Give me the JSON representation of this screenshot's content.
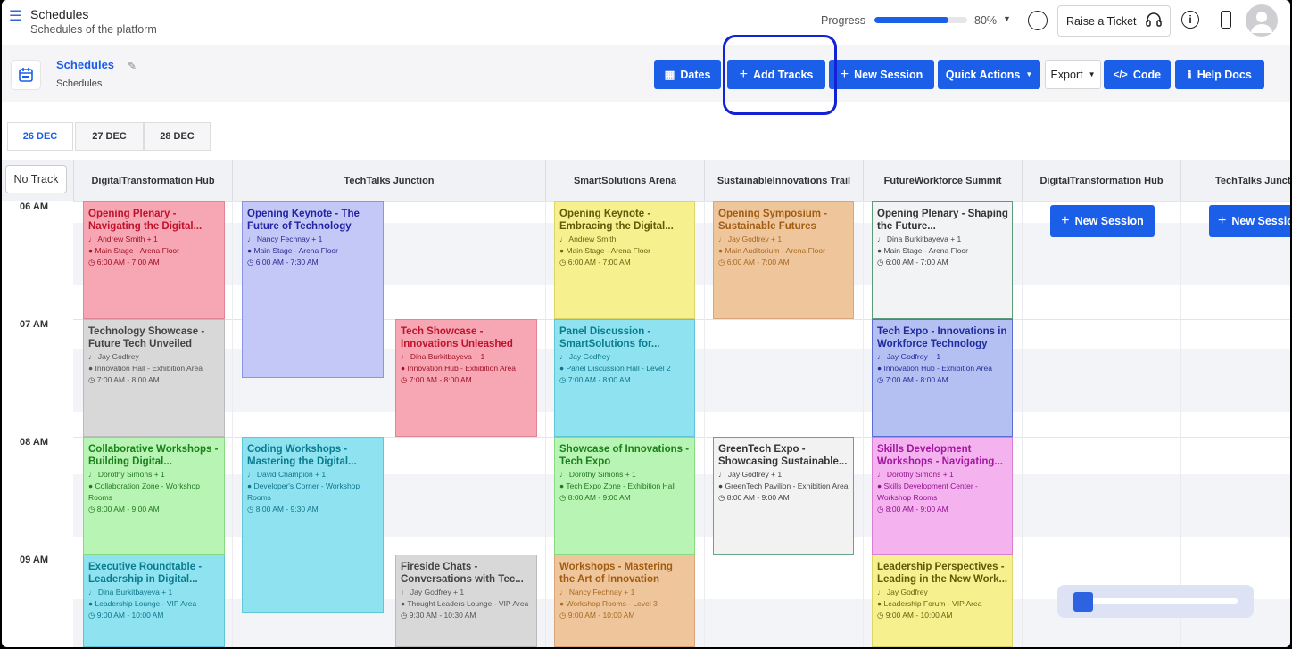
{
  "header": {
    "menu_icon": "hamburger-icon",
    "title": "Schedules",
    "subtitle": "Schedules of the platform",
    "progress_label": "Progress",
    "progress_value": 0.8,
    "progress_text": "80%",
    "raise_ticket": "Raise a Ticket",
    "accent": "#1b5ee8"
  },
  "toolbar": {
    "page_title": "Schedules",
    "page_sub": "Schedules",
    "dates": "Dates",
    "add_tracks": "Add Tracks",
    "new_session": "New Session",
    "quick_actions": "Quick Actions",
    "export": "Export",
    "code": "Code",
    "help_docs": "Help Docs"
  },
  "date_tabs": [
    "26 DEC",
    "27 DEC",
    "28 DEC"
  ],
  "grid": {
    "no_track": "No Track",
    "tracks": [
      "DigitalTransformation Hub",
      "TechTalks Junction",
      "SmartSolutions Arena",
      "SustainableInnovations Trail",
      "FutureWorkforce Summit",
      "DigitalTransformation Hub",
      "TechTalks Junction"
    ],
    "times": [
      "06 AM",
      "07 AM",
      "08 AM",
      "09 AM"
    ],
    "new_session": "New Session"
  },
  "sessions": [
    {
      "title": "Opening Plenary - Navigating the Digital...",
      "speaker": "Andrew Smith + 1",
      "location": "Main Stage - Arena Floor",
      "time": "6:00 AM - 7:00 AM",
      "color": "red"
    },
    {
      "title": "Technology Showcase - Future Tech Unveiled",
      "speaker": "Jay Godfrey",
      "location": "Innovation Hall - Exhibition Area",
      "time": "7:00 AM - 8:00 AM",
      "color": "gray"
    },
    {
      "title": "Collaborative Workshops - Building Digital...",
      "speaker": "Dorothy Simons + 1",
      "location": "Collaboration Zone - Workshop Rooms",
      "time": "8:00 AM - 9:00 AM",
      "color": "green"
    },
    {
      "title": "Executive Roundtable - Leadership in Digital...",
      "speaker": "Dina Burkitbayeva + 1",
      "location": "Leadership Lounge - VIP Area",
      "time": "9:00 AM - 10:00 AM",
      "color": "cyan"
    },
    {
      "title": "Opening Keynote - The Future of Technology",
      "speaker": "Nancy Fechnay + 1",
      "location": "Main Stage - Arena Floor",
      "time": "6:00 AM - 7:30 AM",
      "color": "blue"
    },
    {
      "title": "Coding Workshops - Mastering the Digital...",
      "speaker": "David Champion + 1",
      "location": "Developer's Corner - Workshop Rooms",
      "time": "8:00 AM - 9:30 AM",
      "color": "cyan"
    },
    {
      "title": "Tech Showcase - Innovations Unleashed",
      "speaker": "Dina Burkitbayeva + 1",
      "location": "Innovation Hub - Exhibition Area",
      "time": "7:00 AM - 8:00 AM",
      "color": "red"
    },
    {
      "title": "Fireside Chats - Conversations with Tec...",
      "speaker": "Jay Godfrey + 1",
      "location": "Thought Leaders Lounge - VIP Area",
      "time": "9:30 AM - 10:30 AM",
      "color": "gray"
    },
    {
      "title": "Opening Keynote - Embracing the Digital...",
      "speaker": "Andrew Smith",
      "location": "Main Stage - Arena Floor",
      "time": "6:00 AM - 7:00 AM",
      "color": "yellow"
    },
    {
      "title": "Panel Discussion - SmartSolutions for...",
      "speaker": "Jay Godfrey",
      "location": "Panel Discussion Hall - Level 2",
      "time": "7:00 AM - 8:00 AM",
      "color": "cyan"
    },
    {
      "title": "Showcase of Innovations - Tech Expo",
      "speaker": "Dorothy Simons + 1",
      "location": "Tech Expo Zone - Exhibition Hall",
      "time": "8:00 AM - 9:00 AM",
      "color": "green"
    },
    {
      "title": "Workshops - Mastering the Art of Innovation",
      "speaker": "Nancy Fechnay + 1",
      "location": "Workshop Rooms - Level 3",
      "time": "9:00 AM - 10:00 AM",
      "color": "orange"
    },
    {
      "title": "Opening Symposium - Sustainable Futures",
      "speaker": "Jay Godfrey + 1",
      "location": "Main Auditorium - Arena Floor",
      "time": "6:00 AM - 7:00 AM",
      "color": "orange"
    },
    {
      "title": "GreenTech Expo - Showcasing Sustainable...",
      "speaker": "Jay Godfrey + 1",
      "location": "GreenTech Pavilion - Exhibition Area",
      "time": "8:00 AM - 9:00 AM",
      "color": "ltgray"
    },
    {
      "title": "Opening Plenary - Shaping the Future...",
      "speaker": "Dina Burkitbayeva + 1",
      "location": "Main Stage - Arena Floor",
      "time": "6:00 AM - 7:00 AM",
      "color": "white"
    },
    {
      "title": "Tech Expo - Innovations in Workforce Technology",
      "speaker": "Jay Godfrey + 1",
      "location": "Innovation Hub - Exhibition Area",
      "time": "7:00 AM - 8:00 AM",
      "color": "indigo"
    },
    {
      "title": "Skills Development Workshops - Navigating...",
      "speaker": "Dorothy Simons + 1",
      "location": "Skills Development Center - Workshop Rooms",
      "time": "8:00 AM - 9:00 AM",
      "color": "pink"
    },
    {
      "title": "Leadership Perspectives - Leading in the New Work...",
      "speaker": "Jay Godfrey",
      "location": "Leadership Forum - VIP Area",
      "time": "9:00 AM - 10:00 AM",
      "color": "yellow"
    }
  ]
}
